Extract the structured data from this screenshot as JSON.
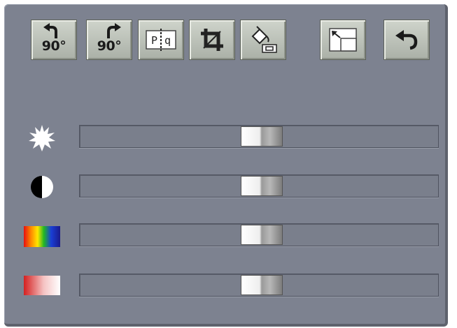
{
  "toolbar": {
    "rotate_left_label": "90°",
    "rotate_right_label": "90°",
    "buttons": [
      {
        "name": "rotate-left",
        "icon": "rotate-left-arrow-icon"
      },
      {
        "name": "rotate-right",
        "icon": "rotate-right-arrow-icon"
      },
      {
        "name": "flip",
        "icon": "flip-mirror-icon",
        "glyph_left": "P",
        "glyph_right": "q"
      },
      {
        "name": "crop",
        "icon": "crop-icon"
      },
      {
        "name": "fill",
        "icon": "paint-bucket-icon"
      },
      {
        "name": "fit",
        "icon": "resize-expand-icon"
      },
      {
        "name": "undo",
        "icon": "undo-arrow-icon"
      }
    ]
  },
  "flip_glyphs": {
    "left": "P",
    "right": "q"
  },
  "sliders": [
    {
      "name": "brightness",
      "icon": "sun-icon",
      "value": 0.5
    },
    {
      "name": "contrast",
      "icon": "contrast-half-circle-icon",
      "value": 0.5
    },
    {
      "name": "saturation",
      "icon": "color-spectrum-icon",
      "value": 0.5
    },
    {
      "name": "tint",
      "icon": "red-gradient-icon",
      "value": 0.5
    }
  ],
  "colors": {
    "panel": "#7d8290",
    "button_face": "#c2c7be",
    "track": "#7a7f8c"
  }
}
